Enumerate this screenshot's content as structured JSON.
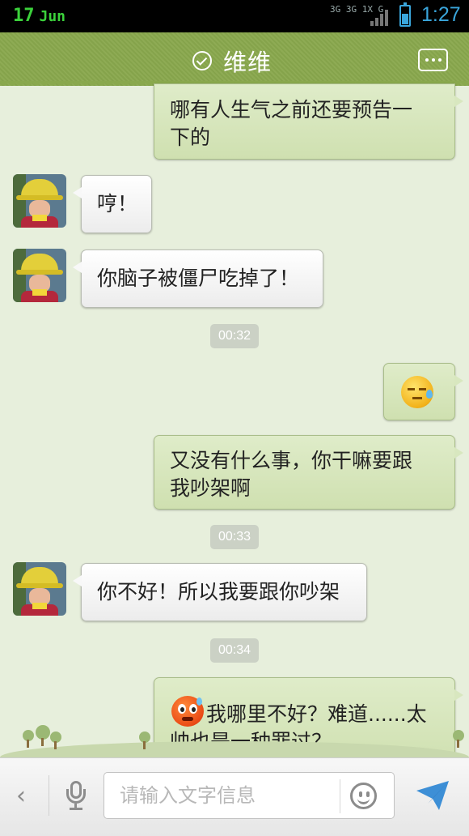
{
  "status_bar": {
    "day": "17",
    "month": "Jun",
    "signal_labels": "3G 3G 1X G",
    "time": "1:27"
  },
  "header": {
    "title": "维维",
    "verified_icon": "check-circle-icon",
    "more_icon": "more-dots-icon",
    "color": "#89a84d"
  },
  "messages": [
    {
      "side": "right",
      "type": "text",
      "text_line1": "哪有人生气之前还要预告一",
      "text_line2": "下的"
    },
    {
      "side": "left",
      "type": "text",
      "text": "哼！"
    },
    {
      "side": "left",
      "type": "text",
      "text": "你脑子被僵尸吃掉了！"
    },
    {
      "type": "time",
      "text": "00:32"
    },
    {
      "side": "right",
      "type": "emoji",
      "emoji": "sweat-face-emoji"
    },
    {
      "side": "right",
      "type": "text",
      "text_line1": "又没有什么事，你干嘛要跟",
      "text_line2": "我吵架啊"
    },
    {
      "type": "time",
      "text": "00:33"
    },
    {
      "side": "left",
      "type": "text",
      "text": "你不好！所以我要跟你吵架"
    },
    {
      "type": "time",
      "text": "00:34"
    },
    {
      "side": "right",
      "type": "text",
      "emoji": "angry-face-emoji",
      "text_line1": "我哪里不好？难道......太",
      "text_line2": "帅也是一种罪过？"
    }
  ],
  "input_bar": {
    "placeholder": "请输入文字信息",
    "back_icon": "chevron-left-icon",
    "voice_icon": "microphone-icon",
    "emoji_icon": "smiley-icon",
    "send_icon": "send-arrow-icon",
    "send_color": "#3d8fd6"
  },
  "colors": {
    "background": "#e7efdc",
    "bubble_right": "#d4e4b8",
    "bubble_left": "#ffffff"
  }
}
